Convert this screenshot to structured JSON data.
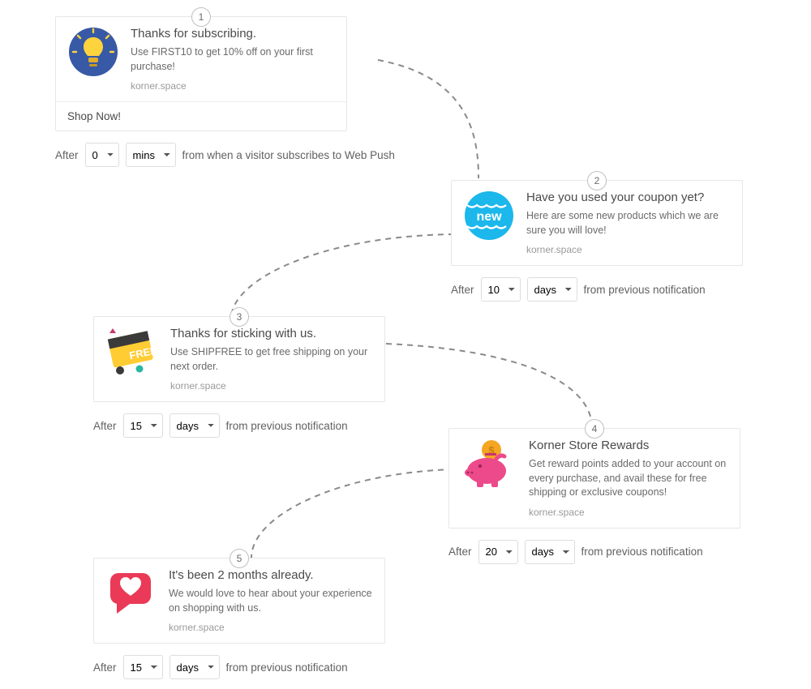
{
  "domain_text": "korner.space",
  "timing_prefix": "After",
  "steps": [
    {
      "num": "1",
      "title": "Thanks for subscribing.",
      "desc": "Use FIRST10 to get 10% off on your first purchase!",
      "cta": "Shop Now!",
      "delay_value": "0",
      "delay_unit": "mins",
      "delay_tail": "from when a visitor subscribes to Web Push"
    },
    {
      "num": "2",
      "title": "Have you used your coupon yet?",
      "desc": "Here are some new products which we are sure you will love!",
      "delay_value": "10",
      "delay_unit": "days",
      "delay_tail": "from previous notification"
    },
    {
      "num": "3",
      "title": "Thanks for sticking with us.",
      "desc": "Use SHIPFREE to get free shipping on your next order.",
      "delay_value": "15",
      "delay_unit": "days",
      "delay_tail": "from previous notification"
    },
    {
      "num": "4",
      "title": "Korner Store Rewards",
      "desc": "Get reward points added to your account on every purchase, and avail these for free shipping or exclusive coupons!",
      "delay_value": "20",
      "delay_unit": "days",
      "delay_tail": "from previous notification"
    },
    {
      "num": "5",
      "title": "It's been 2 months already.",
      "desc": "We would love to hear about your experience on shopping with us.",
      "delay_value": "15",
      "delay_unit": "days",
      "delay_tail": "from previous notification"
    }
  ]
}
